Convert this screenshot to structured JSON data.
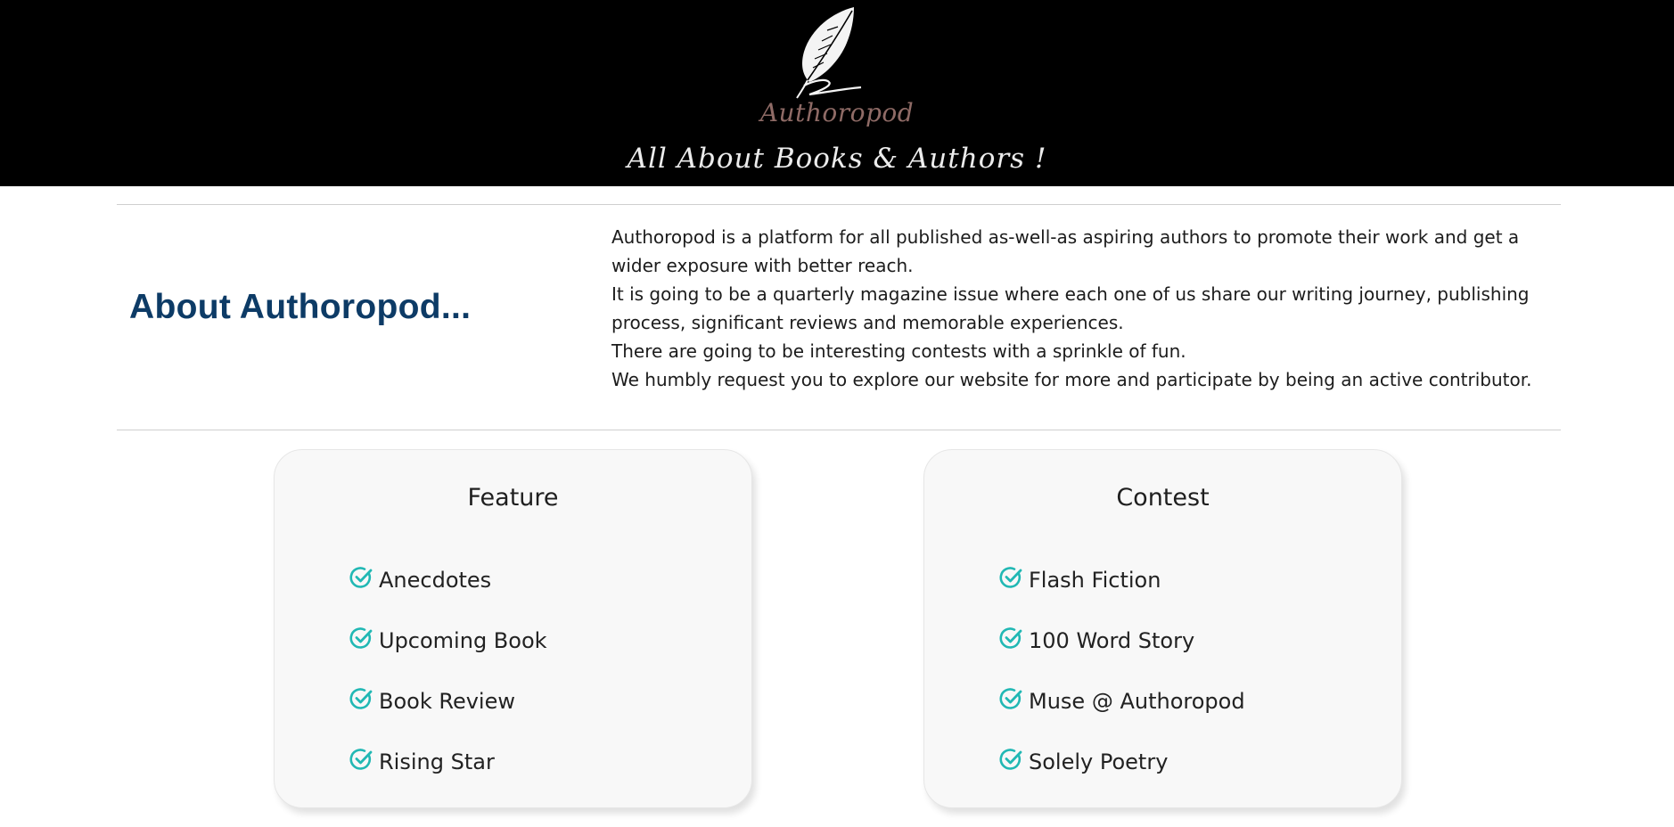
{
  "header": {
    "brand_name": "Authoropod",
    "tagline": "All About Books & Authors !",
    "logo_icon": "quill-feather-icon",
    "background_color": "#000000",
    "brand_color": "#8f6b66"
  },
  "about": {
    "title": "About Authoropod...",
    "paragraphs": [
      "Authoropod is a platform for all published as-well-as aspiring authors to promote their work and get a wider exposure with better reach.",
      "It is going to be a quarterly magazine issue where each one of us share our writing journey, publishing process, significant reviews and memorable experiences.",
      "There are going to be interesting contests with a sprinkle of fun.",
      "We humbly request you to explore our website for more and participate by being an active contributor."
    ],
    "title_color": "#0d3b66"
  },
  "cards": [
    {
      "title": "Feature",
      "items": [
        "Anecdotes",
        "Upcoming Book",
        "Book Review",
        "Rising Star"
      ]
    },
    {
      "title": "Contest",
      "items": [
        "Flash Fiction",
        "100 Word Story",
        "Muse @ Authoropod",
        "Solely Poetry"
      ]
    }
  ],
  "icons": {
    "list_check": "check-circle-icon",
    "check_color": "#21b8b4"
  }
}
